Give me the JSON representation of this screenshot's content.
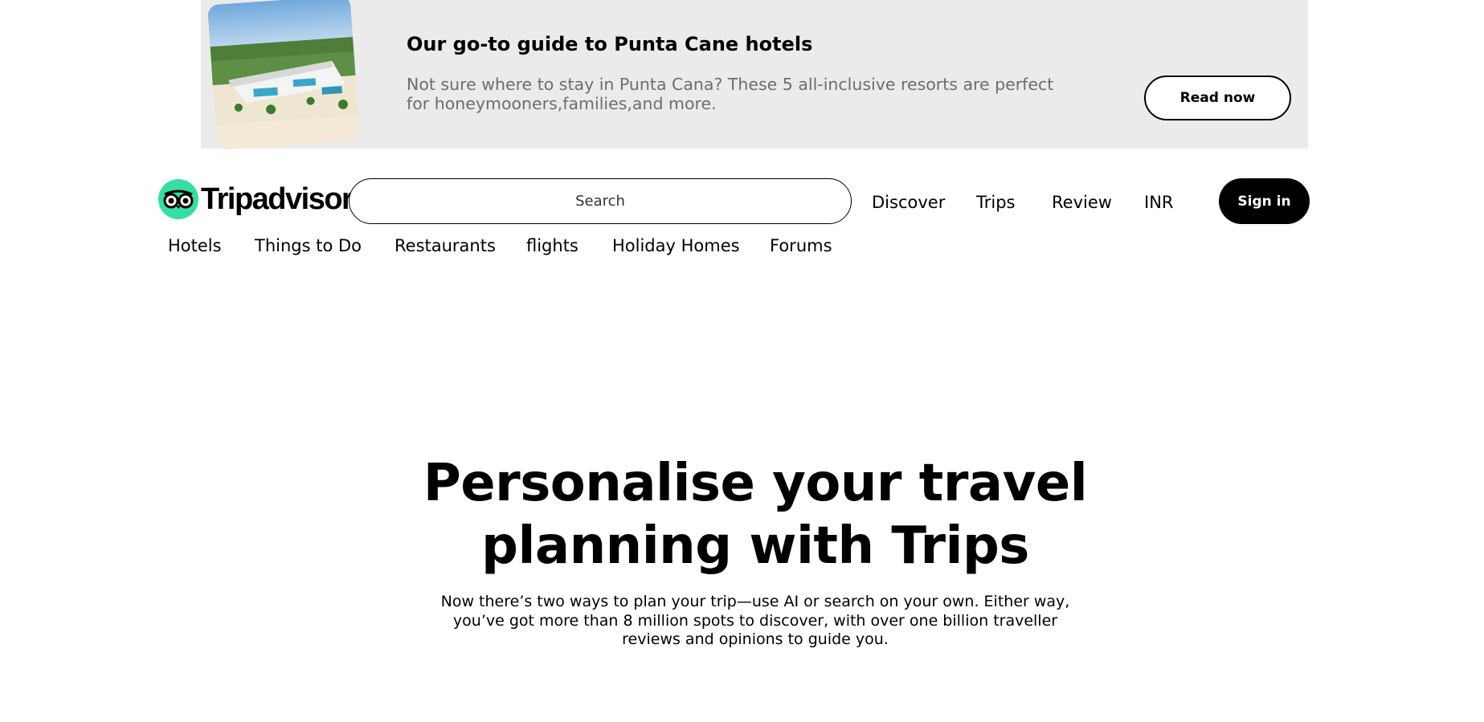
{
  "promo": {
    "title": "Our go-to guide to Punta Cane hotels",
    "description": "Not sure where to stay in Punta Cana? These 5 all-inclusive resorts are perfect for honeymooners,families,and more.",
    "cta_label": "Read now"
  },
  "header": {
    "logo_text": "Tripadvisor",
    "search_placeholder": "Search",
    "nav": [
      "Discover",
      "Trips",
      "Review",
      "INR"
    ],
    "sign_in_label": "Sign in"
  },
  "categories": [
    "Hotels",
    "Things to Do",
    "Restaurants",
    "flights",
    "Holiday Homes",
    "Forums"
  ],
  "hero": {
    "title_line1": "Personalise your travel",
    "title_line2": "planning with Trips",
    "text": "Now there’s two ways to plan your trip—use AI or search on your own. Either way, you’ve got more than 8 million spots to discover, with over one billion traveller reviews and opinions to guide you."
  },
  "colors": {
    "brand_green": "#34e0a1",
    "banner_bg": "#ebebeb",
    "promo_text": "#6d6d6d"
  }
}
